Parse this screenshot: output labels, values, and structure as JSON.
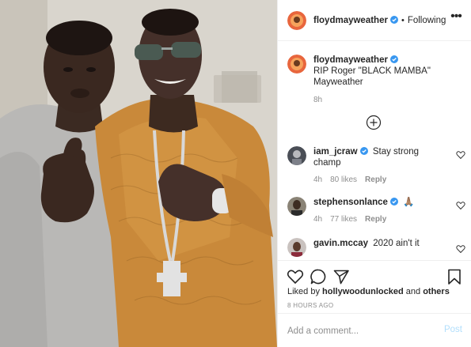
{
  "header": {
    "username": "floydmayweather",
    "dot": "•",
    "following_label": "Following",
    "more_glyph": "•••"
  },
  "caption": {
    "username": "floydmayweather",
    "text": "RIP Roger \"BLACK MAMBA\" Mayweather",
    "time": "8h"
  },
  "comments": [
    {
      "username": "iam_jcraw",
      "verified": true,
      "text": "Stay strong champ",
      "time": "4h",
      "likes": "80 likes",
      "reply": "Reply"
    },
    {
      "username": "stephensonlance",
      "verified": true,
      "text": "🙏🏽",
      "time": "4h",
      "likes": "77 likes",
      "reply": "Reply"
    },
    {
      "username": "gavin.mccay",
      "verified": false,
      "text": "2020 ain't it",
      "time": "",
      "likes": "",
      "reply": ""
    }
  ],
  "actions": {
    "liked_by_prefix": "Liked by",
    "liked_by_user": "hollywoodunlocked",
    "liked_by_and": "and",
    "liked_by_others": "others",
    "time_ago": "8 HOURS AGO"
  },
  "add_comment": {
    "placeholder": "Add a comment...",
    "post_label": "Post"
  },
  "colors": {
    "verified_blue": "#3897f0",
    "muted_text": "#8e8e8e",
    "post_button": "#b2dffc"
  },
  "icons": [
    "verified-icon",
    "more-options-icon",
    "load-more-comments-icon",
    "heart-icon",
    "comment-icon",
    "share-icon",
    "bookmark-icon"
  ]
}
